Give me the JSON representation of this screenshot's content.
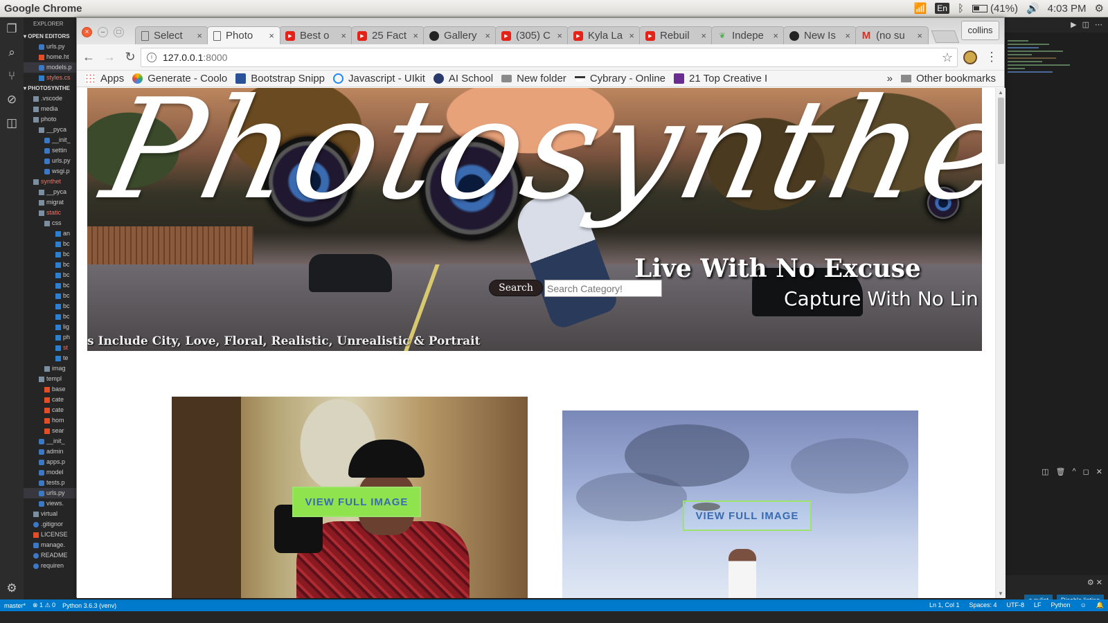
{
  "os": {
    "app_title": "Google Chrome",
    "lang": "En",
    "battery": "(41%)",
    "clock": "4:03 PM"
  },
  "vscode": {
    "explorer_header": "EXPLORER",
    "open_editors": "OPEN EDITORS",
    "open_files": [
      "urls.py",
      "home.ht",
      "models.p",
      "styles.cs"
    ],
    "project": "PHOTOSYNTHE",
    "tree": [
      ".vscode",
      "media",
      "photo",
      "__pyca",
      "__init_",
      "settin",
      "urls.py",
      "wsgi.p",
      "synthet",
      "__pyca",
      "migrat",
      "static",
      "css",
      "an",
      "bc",
      "bc",
      "bc",
      "bc",
      "bc",
      "bc",
      "bc",
      "bc",
      "lig",
      "ph",
      "st",
      "te",
      "imag",
      "templ",
      "base",
      "cate",
      "cate",
      "hom",
      "sear",
      "__init_",
      "admin",
      "apps.p",
      "model",
      "tests.p",
      "urls.py",
      "views.",
      "virtual",
      ".gitignor",
      "LICENSE",
      "manage.",
      "README",
      "requiren"
    ],
    "status_left": [
      "master*",
      "⊗ 1 ⚠ 0",
      "Python 3.6.3 (venv)"
    ],
    "status_right": [
      "Ln 1, Col 1",
      "Spaces: 4",
      "UTF-8",
      "LF",
      "Python"
    ],
    "notif_buttons": [
      "e pylint",
      "Disable linting"
    ]
  },
  "chrome": {
    "tabs": [
      {
        "title": "Select",
        "icon": "doc"
      },
      {
        "title": "Photo",
        "icon": "doc"
      },
      {
        "title": "Best o",
        "icon": "yt"
      },
      {
        "title": "25 Fact",
        "icon": "yt"
      },
      {
        "title": "Gallery",
        "icon": "gh"
      },
      {
        "title": "(305) C",
        "icon": "yt"
      },
      {
        "title": "Kyla La",
        "icon": "yt"
      },
      {
        "title": "Rebuil",
        "icon": "yt"
      },
      {
        "title": "Indepe",
        "icon": "leaf"
      },
      {
        "title": "New Is",
        "icon": "gh"
      },
      {
        "title": "(no su",
        "icon": "gmail"
      }
    ],
    "profile": "collins",
    "url_host": "127.0.0.1",
    "url_port": ":8000",
    "bookmarks": [
      {
        "label": "Apps",
        "icon": "apps"
      },
      {
        "label": "Generate - Coolo",
        "icon": "coolors"
      },
      {
        "label": "Bootstrap Snipp",
        "icon": "boot"
      },
      {
        "label": "Javascript - UIkit",
        "icon": "uikit"
      },
      {
        "label": "AI School",
        "icon": "ai"
      },
      {
        "label": "New folder",
        "icon": "folder"
      },
      {
        "label": "Cybrary - Online",
        "icon": "cyb"
      },
      {
        "label": "21 Top Creative I",
        "icon": "top21"
      }
    ],
    "bookmarks_more": "»",
    "other_bookmarks": "Other bookmarks"
  },
  "page": {
    "hero": {
      "title": "Photosynthetic",
      "slogan": "Live With No Excuse",
      "subtitle": "Capture With No Lin",
      "categories": "s Include City, Love, Floral, Realistic, Unrealistic & Portrait"
    },
    "search": {
      "button": "Search",
      "placeholder": "Search Category!"
    },
    "gallery": [
      {
        "button": "VIEW FULL IMAGE"
      },
      {
        "button": "VIEW FULL IMAGE"
      }
    ]
  }
}
